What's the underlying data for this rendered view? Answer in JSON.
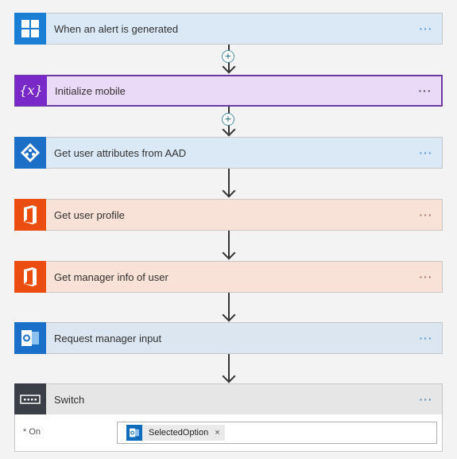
{
  "steps": [
    {
      "title": "When an alert is generated",
      "icon": "windows-logo-icon",
      "color": "#1a7fd4",
      "bg": "#dbe9f7"
    },
    {
      "title": "Initialize mobile",
      "icon": "variable-icon",
      "color": "#7a29c9",
      "bg": "#ead9f7"
    },
    {
      "title": "Get user attributes from AAD",
      "icon": "azure-ad-icon",
      "color": "#1c6fc7",
      "bg": "#dbe9f7"
    },
    {
      "title": "Get user profile",
      "icon": "office-icon",
      "color": "#eb4c10",
      "bg": "#f8e1d6"
    },
    {
      "title": "Get manager info of user",
      "icon": "office-icon",
      "color": "#eb4c10",
      "bg": "#f8e1d6"
    },
    {
      "title": "Request manager input",
      "icon": "outlook-icon",
      "color": "#1a6fc9",
      "bg": "#dbe6f1"
    },
    {
      "title": "Switch",
      "icon": "switch-icon",
      "color": "#3a3f47",
      "bg": "#e6e6e6"
    }
  ],
  "more_label": "···",
  "switch_on": {
    "label": "* On",
    "token_label": "SelectedOption",
    "token_remove": "×"
  }
}
